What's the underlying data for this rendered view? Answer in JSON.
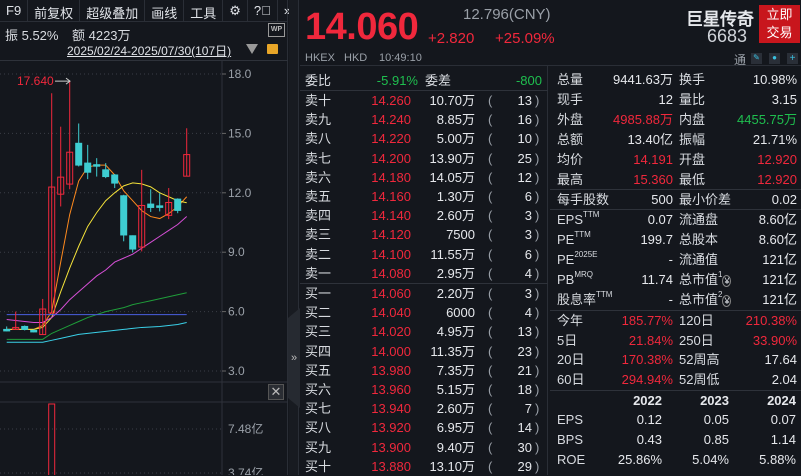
{
  "toolbar": {
    "items": [
      "F9",
      "前复权",
      "超级叠加",
      "画线",
      "工具"
    ],
    "settings_icon": "gear-icon",
    "help_icon": "question-icon",
    "more_icon": "chevrons-right-icon"
  },
  "chart_info": {
    "amplitude": "振 5.52%",
    "amount": "额 4223万",
    "wp_badge": "WP",
    "date_range": "2025/02/24-2025/07/30(107日)"
  },
  "chart_data": {
    "type": "candlestick",
    "y_ticks": [
      "18.0",
      "15.0",
      "12.0",
      "9.0",
      "6.0",
      "3.0"
    ],
    "ylim": [
      3,
      18
    ],
    "high_label": "17.640",
    "candles": [
      {
        "o": 5.1,
        "c": 5.05,
        "h": 5.25,
        "l": 5.0
      },
      {
        "o": 5.1,
        "c": 5.2,
        "h": 6.0,
        "l": 5.1
      },
      {
        "o": 5.25,
        "c": 5.1,
        "h": 5.3,
        "l": 5.05
      },
      {
        "o": 5.05,
        "c": 5.0,
        "h": 5.1,
        "l": 4.95
      },
      {
        "o": 4.84,
        "c": 6.13,
        "h": 6.64,
        "l": 4.84
      },
      {
        "o": 5.93,
        "c": 12.29,
        "h": 17.03,
        "l": 5.9
      },
      {
        "o": 11.93,
        "c": 12.79,
        "h": 15.34,
        "l": 11.31
      },
      {
        "o": 12.44,
        "c": 14.05,
        "h": 17.64,
        "l": 12.18
      },
      {
        "o": 14.5,
        "c": 13.4,
        "h": 15.5,
        "l": 13.33
      },
      {
        "o": 13.5,
        "c": 13.04,
        "h": 14.42,
        "l": 12.69
      },
      {
        "o": 13.42,
        "c": 13.38,
        "h": 13.75,
        "l": 12.82
      },
      {
        "o": 13.16,
        "c": 12.82,
        "h": 13.5,
        "l": 12.74
      },
      {
        "o": 12.9,
        "c": 12.49,
        "h": 12.95,
        "l": 12.24
      },
      {
        "o": 11.85,
        "c": 9.87,
        "h": 11.9,
        "l": 9.55
      },
      {
        "o": 9.83,
        "c": 9.16,
        "h": 9.85,
        "l": 8.99
      },
      {
        "o": 9.26,
        "c": 11.36,
        "h": 13.16,
        "l": 9.04
      },
      {
        "o": 11.43,
        "c": 11.26,
        "h": 12.18,
        "l": 11.03
      },
      {
        "o": 11.34,
        "c": 11.27,
        "h": 11.98,
        "l": 11.06
      },
      {
        "o": 10.86,
        "c": 11.51,
        "h": 12.24,
        "l": 10.67
      },
      {
        "o": 11.68,
        "c": 11.11,
        "h": 11.72,
        "l": 10.97
      },
      {
        "o": 12.84,
        "c": 13.93,
        "h": 15.26,
        "l": 12.84
      }
    ],
    "ma_lines": [
      {
        "color": "#ff8a1e",
        "values": [
          5.1,
          5.1,
          5.1,
          5.1,
          5.3,
          6.0,
          8.5,
          10.9,
          12.6,
          13.3,
          13.4,
          13.4,
          12.9,
          12.1,
          11.6,
          11.1,
          10.8,
          10.7,
          10.95,
          11.3,
          11.8
        ]
      },
      {
        "color": "#f5e33a",
        "values": [
          5.1,
          5.1,
          5.1,
          5.1,
          5.2,
          5.7,
          7.0,
          8.2,
          9.3,
          10.3,
          11.0,
          11.6,
          12.0,
          12.35,
          12.5,
          12.45,
          12.3,
          12.0,
          11.8,
          11.6,
          11.5
        ]
      },
      {
        "color": "#d64fd6",
        "values": [
          5.6,
          5.55,
          5.5,
          5.45,
          5.45,
          5.7,
          6.1,
          6.6,
          7.0,
          7.4,
          7.8,
          8.1,
          8.5,
          8.7,
          8.9,
          9.2,
          9.5,
          9.8,
          10.1,
          10.4,
          10.8
        ]
      },
      {
        "color": "#1f9e3a",
        "values": [
          4.6,
          4.6,
          4.6,
          4.6,
          4.6,
          4.9,
          5.1,
          5.3,
          5.5,
          5.7,
          5.85,
          6.0,
          6.1,
          6.2,
          6.35,
          6.45,
          6.55,
          6.65,
          6.75,
          6.85,
          6.95
        ]
      },
      {
        "color": "#3ad0e8",
        "values": [
          4.45,
          4.45,
          4.45,
          4.45,
          4.45,
          4.55,
          4.65,
          4.75,
          4.85,
          4.9,
          4.95,
          5.0,
          5.05,
          5.1,
          5.15,
          5.2,
          5.22,
          5.25,
          5.3,
          5.35,
          5.45
        ]
      },
      {
        "color": "#4a5fe0",
        "values": [
          5.85,
          5.85,
          5.85,
          5.85,
          5.85,
          5.85,
          5.85,
          5.85,
          5.85,
          5.85,
          5.85,
          5.85,
          5.85,
          5.85,
          5.85,
          5.85,
          5.85,
          5.85,
          5.85,
          5.85,
          5.85
        ]
      }
    ],
    "volume_ticks": [
      "7.48亿",
      "3.74亿"
    ]
  },
  "quote": {
    "price": "14.060",
    "cny_price": "12.796(CNY)",
    "change": "+2.820",
    "change_pct": "+25.09%",
    "name": "巨星传奇",
    "code": "6683",
    "trade_button": "立即交易",
    "exchange": "HKEX",
    "currency": "HKD",
    "time": "10:49:10",
    "tong": "通"
  },
  "colors": {
    "up": "#f0283c",
    "down": "#1fbf4f",
    "candle_down": "#3ecdd1",
    "trade_button": "#c8161d"
  },
  "order_book": {
    "ratio_label": "委比",
    "ratio": "-5.91%",
    "diff_label": "委差",
    "diff": "-800",
    "asks": [
      {
        "label": "卖十",
        "price": "14.260",
        "vol": "10.70万",
        "count": "13"
      },
      {
        "label": "卖九",
        "price": "14.240",
        "vol": "8.85万",
        "count": "16"
      },
      {
        "label": "卖八",
        "price": "14.220",
        "vol": "5.00万",
        "count": "10"
      },
      {
        "label": "卖七",
        "price": "14.200",
        "vol": "13.90万",
        "count": "25"
      },
      {
        "label": "卖六",
        "price": "14.180",
        "vol": "14.05万",
        "count": "12"
      },
      {
        "label": "卖五",
        "price": "14.160",
        "vol": "1.30万",
        "count": "6"
      },
      {
        "label": "卖四",
        "price": "14.140",
        "vol": "2.60万",
        "count": "3"
      },
      {
        "label": "卖三",
        "price": "14.120",
        "vol": "7500",
        "count": "3"
      },
      {
        "label": "卖二",
        "price": "14.100",
        "vol": "11.55万",
        "count": "6"
      },
      {
        "label": "卖一",
        "price": "14.080",
        "vol": "2.95万",
        "count": "4"
      }
    ],
    "bids": [
      {
        "label": "买一",
        "price": "14.060",
        "vol": "2.20万",
        "count": "3"
      },
      {
        "label": "买二",
        "price": "14.040",
        "vol": "6000",
        "count": "4"
      },
      {
        "label": "买三",
        "price": "14.020",
        "vol": "4.95万",
        "count": "13"
      },
      {
        "label": "买四",
        "price": "14.000",
        "vol": "11.35万",
        "count": "23"
      },
      {
        "label": "买五",
        "price": "13.980",
        "vol": "7.35万",
        "count": "21"
      },
      {
        "label": "买六",
        "price": "13.960",
        "vol": "5.15万",
        "count": "18"
      },
      {
        "label": "买七",
        "price": "13.940",
        "vol": "2.60万",
        "count": "7"
      },
      {
        "label": "买八",
        "price": "13.920",
        "vol": "6.95万",
        "count": "14"
      },
      {
        "label": "买九",
        "price": "13.900",
        "vol": "9.40万",
        "count": "30"
      },
      {
        "label": "买十",
        "price": "13.880",
        "vol": "13.10万",
        "count": "29"
      }
    ]
  },
  "stats": {
    "block1": [
      [
        "总量",
        "9441.63万",
        "white",
        "换手",
        "10.98%",
        "white"
      ],
      [
        "现手",
        "12",
        "white",
        "量比",
        "3.15",
        "white"
      ],
      [
        "外盘",
        "4985.88万",
        "red",
        "内盘",
        "4455.75万",
        "green"
      ],
      [
        "总额",
        "13.40亿",
        "white",
        "振幅",
        "21.71%",
        "white"
      ],
      [
        "均价",
        "14.191",
        "red",
        "开盘",
        "12.920",
        "red"
      ],
      [
        "最高",
        "15.360",
        "red",
        "最低",
        "12.920",
        "red"
      ]
    ],
    "block2": [
      [
        "每手股数",
        "500",
        "white",
        "最小价差",
        "0.02",
        "white"
      ]
    ],
    "block3": [
      [
        "EPS",
        "TTM",
        "0.07",
        "流通盘",
        "",
        "8.60亿"
      ],
      [
        "PE",
        "TTM",
        "199.7",
        "总股本",
        "",
        "8.60亿"
      ],
      [
        "PE",
        "2025E",
        "-",
        "流通值",
        "",
        "121亿"
      ],
      [
        "PB",
        "MRQ",
        "11.74",
        "总市值",
        "1",
        "121亿"
      ],
      [
        "股息率",
        "TTM",
        "-",
        "总市值",
        "2",
        "121亿"
      ]
    ],
    "block4": [
      [
        "今年",
        "185.77%",
        "red",
        "120日",
        "210.38%",
        "red"
      ],
      [
        "5日",
        "21.84%",
        "red",
        "250日",
        "33.90%",
        "red"
      ],
      [
        "20日",
        "170.38%",
        "red",
        "52周高",
        "17.64",
        "white"
      ],
      [
        "60日",
        "294.94%",
        "red",
        "52周低",
        "2.04",
        "white"
      ]
    ],
    "fin_years": [
      "2022",
      "2023",
      "2024"
    ],
    "fin_rows": [
      [
        "EPS",
        "0.12",
        "0.05",
        "0.07"
      ],
      [
        "BPS",
        "0.43",
        "0.85",
        "1.14"
      ],
      [
        "ROE",
        "25.86%",
        "5.04%",
        "5.88%"
      ]
    ]
  }
}
